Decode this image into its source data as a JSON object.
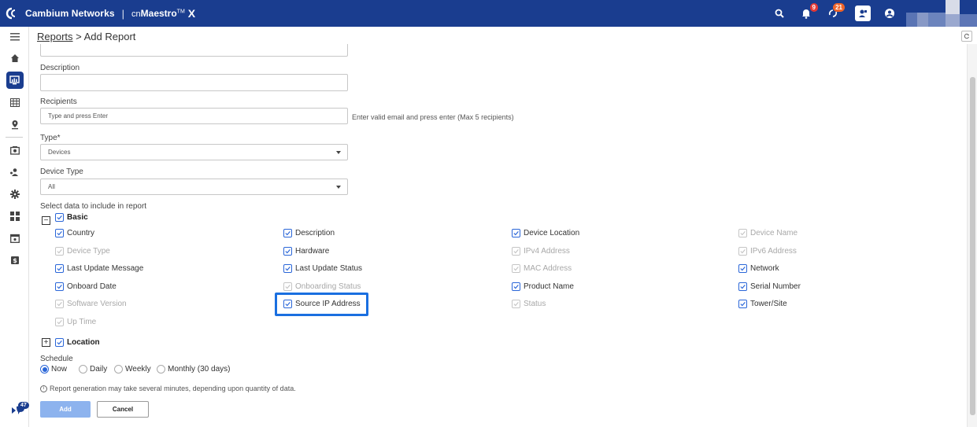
{
  "app": {
    "brand": "Cambium Networks",
    "separator": "|",
    "product_prefix": "cn",
    "product_name": "Maestro",
    "product_tm": "TM",
    "product_suffix": "X"
  },
  "topbar": {
    "icons": [
      {
        "name": "search-icon"
      },
      {
        "name": "bell-icon",
        "badge": "9"
      },
      {
        "name": "sync-icon",
        "badge": "21"
      },
      {
        "name": "help-icon"
      },
      {
        "name": "user-icon"
      }
    ],
    "colors": {
      "bar": "#1a3d8f",
      "badge_red": "#e53935",
      "badge_orange": "#f0642a"
    }
  },
  "sidebar": {
    "items": [
      {
        "name": "menu-icon"
      },
      {
        "name": "home-icon"
      },
      {
        "name": "monitor-icon",
        "active": true
      },
      {
        "name": "table-icon"
      },
      {
        "name": "location-pin-icon"
      },
      {
        "name": "camera-icon"
      },
      {
        "name": "users-icon"
      },
      {
        "name": "gear-icon"
      },
      {
        "name": "apps-icon"
      },
      {
        "name": "calendar-icon"
      },
      {
        "name": "billing-icon"
      }
    ],
    "bottom_badge": "47"
  },
  "breadcrumb": {
    "root": "Reports",
    "separator": " > ",
    "current": "Add Report"
  },
  "form": {
    "description_label": "Description",
    "description_value": "",
    "recipients_label": "Recipients",
    "recipients_placeholder": "Type and press Enter",
    "recipients_hint": "Enter valid email and press enter (Max 5 recipients)",
    "type_label": "Type*",
    "type_value": "Devices",
    "device_type_label": "Device Type",
    "device_type_value": "All",
    "select_data_label": "Select data to include in report",
    "basic_group": {
      "label": "Basic",
      "toggle": "−",
      "items": [
        {
          "label": "Country",
          "checked": true,
          "disabled": false
        },
        {
          "label": "Description",
          "checked": true,
          "disabled": false
        },
        {
          "label": "Device Location",
          "checked": true,
          "disabled": false
        },
        {
          "label": "Device Name",
          "checked": true,
          "disabled": true
        },
        {
          "label": "Device Type",
          "checked": true,
          "disabled": true
        },
        {
          "label": "Hardware",
          "checked": true,
          "disabled": false
        },
        {
          "label": "IPv4 Address",
          "checked": true,
          "disabled": true
        },
        {
          "label": "IPv6 Address",
          "checked": true,
          "disabled": true
        },
        {
          "label": "Last Update Message",
          "checked": true,
          "disabled": false
        },
        {
          "label": "Last Update Status",
          "checked": true,
          "disabled": false
        },
        {
          "label": "MAC Address",
          "checked": true,
          "disabled": true
        },
        {
          "label": "Network",
          "checked": true,
          "disabled": false
        },
        {
          "label": "Onboard Date",
          "checked": true,
          "disabled": false
        },
        {
          "label": "Onboarding Status",
          "checked": true,
          "disabled": true
        },
        {
          "label": "Product Name",
          "checked": true,
          "disabled": false
        },
        {
          "label": "Serial Number",
          "checked": true,
          "disabled": false
        },
        {
          "label": "Software Version",
          "checked": true,
          "disabled": true
        },
        {
          "label": "Source IP Address",
          "checked": true,
          "disabled": false,
          "highlighted": true
        },
        {
          "label": "Status",
          "checked": true,
          "disabled": true
        },
        {
          "label": "Tower/Site",
          "checked": true,
          "disabled": false
        },
        {
          "label": "Up Time",
          "checked": true,
          "disabled": true
        }
      ]
    },
    "location_group": {
      "label": "Location",
      "toggle": "+"
    },
    "schedule_label": "Schedule",
    "schedule_options": [
      {
        "label": "Now",
        "selected": true
      },
      {
        "label": "Daily",
        "selected": false
      },
      {
        "label": "Weekly",
        "selected": false
      },
      {
        "label": "Monthly (30 days)",
        "selected": false
      }
    ],
    "note_icon": "info-icon",
    "note": "Report generation may take several minutes, depending upon quantity of data.",
    "add_label": "Add",
    "cancel_label": "Cancel"
  },
  "colors": {
    "accent": "#2a66d8",
    "highlight": "#1a6fe0",
    "add_button": "#8db3ee"
  }
}
